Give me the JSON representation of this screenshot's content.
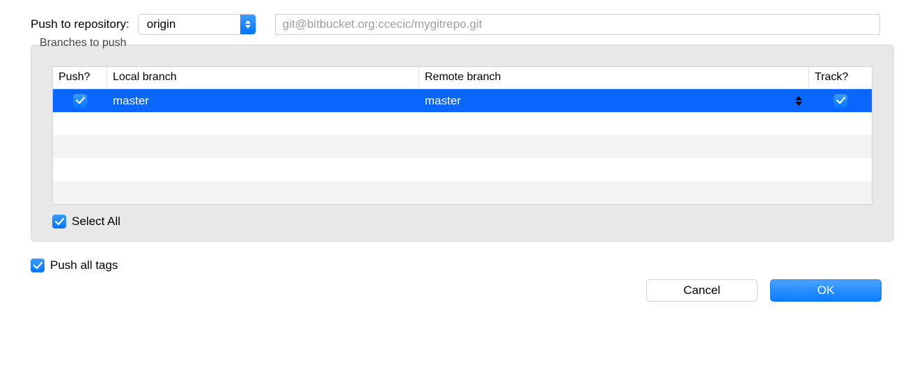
{
  "labels": {
    "push_to_repo": "Push to repository:",
    "branches_to_push": "Branches to push",
    "select_all": "Select All",
    "push_all_tags": "Push all tags"
  },
  "remote": {
    "selected": "origin",
    "url": "git@bitbucket.org:ccecic/mygitrepo.git"
  },
  "table": {
    "headers": {
      "push": "Push?",
      "local": "Local branch",
      "remote": "Remote branch",
      "track": "Track?"
    },
    "rows": [
      {
        "push": true,
        "local": "master",
        "remote": "master",
        "track": true,
        "selected": true
      }
    ]
  },
  "checkboxes": {
    "select_all": true,
    "push_all_tags": true
  },
  "buttons": {
    "cancel": "Cancel",
    "ok": "OK"
  }
}
